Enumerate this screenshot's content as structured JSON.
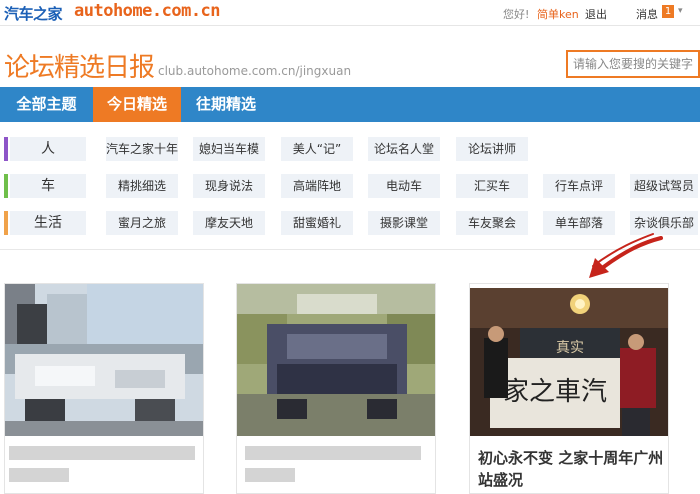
{
  "topbar": {
    "logo_cn": "汽车之家",
    "logo_url": "autohome.com.cn",
    "greeting": "您好!",
    "username": "简单ken",
    "logout": "退出",
    "messages": "消息",
    "message_count": "1",
    "caret": "▾"
  },
  "header": {
    "title": "论坛精选日报",
    "url": "club.autohome.com.cn/jingxuan",
    "search_placeholder": "请输入您要搜的关键字"
  },
  "nav": {
    "items": [
      {
        "label": "全部主题",
        "active": false
      },
      {
        "label": "今日精选",
        "active": true
      },
      {
        "label": "往期精选",
        "active": false
      }
    ]
  },
  "categories": [
    {
      "name": "人",
      "color": "#8e55c8",
      "tags": [
        "汽车之家十年",
        "媳妇当车模",
        "美人“记”",
        "论坛名人堂",
        "论坛讲师"
      ]
    },
    {
      "name": "车",
      "color": "#6fbf4a",
      "tags": [
        "精挑细选",
        "现身说法",
        "高端阵地",
        "电动车",
        "汇买车",
        "行车点评",
        "超级试驾员"
      ]
    },
    {
      "name": "生活",
      "color": "#f0a24a",
      "tags": [
        "蜜月之旅",
        "摩友天地",
        "甜蜜婚礼",
        "摄影课堂",
        "车友聚会",
        "单车部落",
        "杂谈俱乐部"
      ]
    }
  ],
  "cards": [
    {
      "title": ""
    },
    {
      "title": ""
    },
    {
      "title": "初心永不变 之家十周年广州站盛况"
    }
  ],
  "colors": {
    "accent_orange": "#ee7a24",
    "nav_blue": "#2f86c8",
    "logo_blue": "#1b5fb6"
  }
}
